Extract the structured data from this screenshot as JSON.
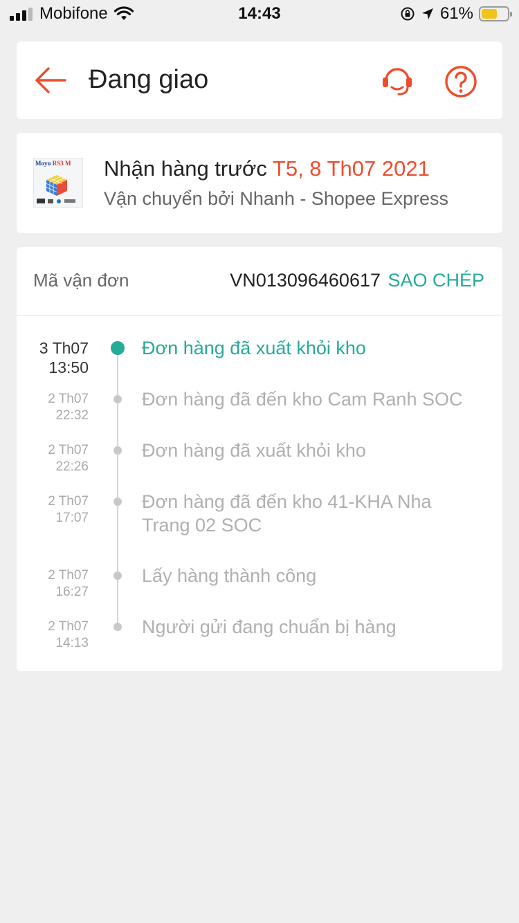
{
  "status_bar": {
    "carrier": "Mobifone",
    "time": "14:43",
    "battery_percent": "61%",
    "battery_level": 0.61
  },
  "header": {
    "title": "Đang giao",
    "back_icon": "back-arrow-icon",
    "support_icon": "headset-icon",
    "help_icon": "question-circle-icon",
    "accent_color": "#ee4d2d"
  },
  "delivery": {
    "receive_prefix": "Nhận hàng trước",
    "receive_date": "T5, 8 Th07 2021",
    "shipping_text": "Vận chuyển bởi Nhanh  - Shopee Express",
    "thumbnail": {
      "brand": "Moyu",
      "model": "RS3 M"
    }
  },
  "tracking": {
    "label": "Mã vận đơn",
    "number": "VN013096460617",
    "copy_label": "SAO CHÉP",
    "accent_color": "#26aa99",
    "events": [
      {
        "date": "3 Th07",
        "time": "13:50",
        "text": "Đơn hàng đã xuất khỏi kho",
        "active": true
      },
      {
        "date": "2 Th07",
        "time": "22:32",
        "text": "Đơn hàng đã đến kho Cam Ranh SOC",
        "active": false
      },
      {
        "date": "2 Th07",
        "time": "22:26",
        "text": "Đơn hàng đã xuất khỏi kho",
        "active": false
      },
      {
        "date": "2 Th07",
        "time": "17:07",
        "text": "Đơn hàng đã đến kho 41-KHA Nha Trang 02 SOC",
        "active": false
      },
      {
        "date": "2 Th07",
        "time": "16:27",
        "text": "Lấy hàng thành công",
        "active": false
      },
      {
        "date": "2 Th07",
        "time": "14:13",
        "text": "Người gửi đang chuẩn bị hàng",
        "active": false
      }
    ]
  }
}
